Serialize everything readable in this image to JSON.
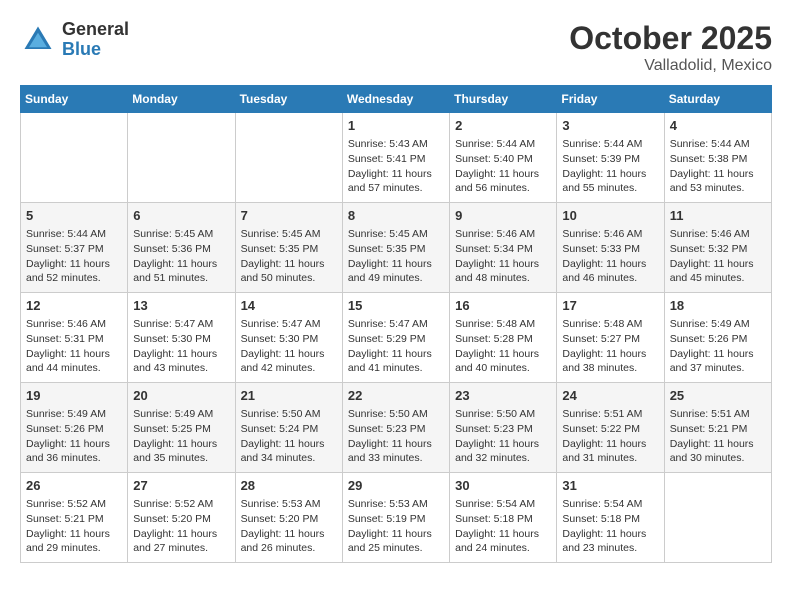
{
  "header": {
    "logo": {
      "general": "General",
      "blue": "Blue"
    },
    "month": "October 2025",
    "location": "Valladolid, Mexico"
  },
  "days_of_week": [
    "Sunday",
    "Monday",
    "Tuesday",
    "Wednesday",
    "Thursday",
    "Friday",
    "Saturday"
  ],
  "weeks": [
    [
      {
        "day": "",
        "sunrise": "",
        "sunset": "",
        "daylight": ""
      },
      {
        "day": "",
        "sunrise": "",
        "sunset": "",
        "daylight": ""
      },
      {
        "day": "",
        "sunrise": "",
        "sunset": "",
        "daylight": ""
      },
      {
        "day": "1",
        "sunrise": "Sunrise: 5:43 AM",
        "sunset": "Sunset: 5:41 PM",
        "daylight": "Daylight: 11 hours and 57 minutes."
      },
      {
        "day": "2",
        "sunrise": "Sunrise: 5:44 AM",
        "sunset": "Sunset: 5:40 PM",
        "daylight": "Daylight: 11 hours and 56 minutes."
      },
      {
        "day": "3",
        "sunrise": "Sunrise: 5:44 AM",
        "sunset": "Sunset: 5:39 PM",
        "daylight": "Daylight: 11 hours and 55 minutes."
      },
      {
        "day": "4",
        "sunrise": "Sunrise: 5:44 AM",
        "sunset": "Sunset: 5:38 PM",
        "daylight": "Daylight: 11 hours and 53 minutes."
      }
    ],
    [
      {
        "day": "5",
        "sunrise": "Sunrise: 5:44 AM",
        "sunset": "Sunset: 5:37 PM",
        "daylight": "Daylight: 11 hours and 52 minutes."
      },
      {
        "day": "6",
        "sunrise": "Sunrise: 5:45 AM",
        "sunset": "Sunset: 5:36 PM",
        "daylight": "Daylight: 11 hours and 51 minutes."
      },
      {
        "day": "7",
        "sunrise": "Sunrise: 5:45 AM",
        "sunset": "Sunset: 5:35 PM",
        "daylight": "Daylight: 11 hours and 50 minutes."
      },
      {
        "day": "8",
        "sunrise": "Sunrise: 5:45 AM",
        "sunset": "Sunset: 5:35 PM",
        "daylight": "Daylight: 11 hours and 49 minutes."
      },
      {
        "day": "9",
        "sunrise": "Sunrise: 5:46 AM",
        "sunset": "Sunset: 5:34 PM",
        "daylight": "Daylight: 11 hours and 48 minutes."
      },
      {
        "day": "10",
        "sunrise": "Sunrise: 5:46 AM",
        "sunset": "Sunset: 5:33 PM",
        "daylight": "Daylight: 11 hours and 46 minutes."
      },
      {
        "day": "11",
        "sunrise": "Sunrise: 5:46 AM",
        "sunset": "Sunset: 5:32 PM",
        "daylight": "Daylight: 11 hours and 45 minutes."
      }
    ],
    [
      {
        "day": "12",
        "sunrise": "Sunrise: 5:46 AM",
        "sunset": "Sunset: 5:31 PM",
        "daylight": "Daylight: 11 hours and 44 minutes."
      },
      {
        "day": "13",
        "sunrise": "Sunrise: 5:47 AM",
        "sunset": "Sunset: 5:30 PM",
        "daylight": "Daylight: 11 hours and 43 minutes."
      },
      {
        "day": "14",
        "sunrise": "Sunrise: 5:47 AM",
        "sunset": "Sunset: 5:30 PM",
        "daylight": "Daylight: 11 hours and 42 minutes."
      },
      {
        "day": "15",
        "sunrise": "Sunrise: 5:47 AM",
        "sunset": "Sunset: 5:29 PM",
        "daylight": "Daylight: 11 hours and 41 minutes."
      },
      {
        "day": "16",
        "sunrise": "Sunrise: 5:48 AM",
        "sunset": "Sunset: 5:28 PM",
        "daylight": "Daylight: 11 hours and 40 minutes."
      },
      {
        "day": "17",
        "sunrise": "Sunrise: 5:48 AM",
        "sunset": "Sunset: 5:27 PM",
        "daylight": "Daylight: 11 hours and 38 minutes."
      },
      {
        "day": "18",
        "sunrise": "Sunrise: 5:49 AM",
        "sunset": "Sunset: 5:26 PM",
        "daylight": "Daylight: 11 hours and 37 minutes."
      }
    ],
    [
      {
        "day": "19",
        "sunrise": "Sunrise: 5:49 AM",
        "sunset": "Sunset: 5:26 PM",
        "daylight": "Daylight: 11 hours and 36 minutes."
      },
      {
        "day": "20",
        "sunrise": "Sunrise: 5:49 AM",
        "sunset": "Sunset: 5:25 PM",
        "daylight": "Daylight: 11 hours and 35 minutes."
      },
      {
        "day": "21",
        "sunrise": "Sunrise: 5:50 AM",
        "sunset": "Sunset: 5:24 PM",
        "daylight": "Daylight: 11 hours and 34 minutes."
      },
      {
        "day": "22",
        "sunrise": "Sunrise: 5:50 AM",
        "sunset": "Sunset: 5:23 PM",
        "daylight": "Daylight: 11 hours and 33 minutes."
      },
      {
        "day": "23",
        "sunrise": "Sunrise: 5:50 AM",
        "sunset": "Sunset: 5:23 PM",
        "daylight": "Daylight: 11 hours and 32 minutes."
      },
      {
        "day": "24",
        "sunrise": "Sunrise: 5:51 AM",
        "sunset": "Sunset: 5:22 PM",
        "daylight": "Daylight: 11 hours and 31 minutes."
      },
      {
        "day": "25",
        "sunrise": "Sunrise: 5:51 AM",
        "sunset": "Sunset: 5:21 PM",
        "daylight": "Daylight: 11 hours and 30 minutes."
      }
    ],
    [
      {
        "day": "26",
        "sunrise": "Sunrise: 5:52 AM",
        "sunset": "Sunset: 5:21 PM",
        "daylight": "Daylight: 11 hours and 29 minutes."
      },
      {
        "day": "27",
        "sunrise": "Sunrise: 5:52 AM",
        "sunset": "Sunset: 5:20 PM",
        "daylight": "Daylight: 11 hours and 27 minutes."
      },
      {
        "day": "28",
        "sunrise": "Sunrise: 5:53 AM",
        "sunset": "Sunset: 5:20 PM",
        "daylight": "Daylight: 11 hours and 26 minutes."
      },
      {
        "day": "29",
        "sunrise": "Sunrise: 5:53 AM",
        "sunset": "Sunset: 5:19 PM",
        "daylight": "Daylight: 11 hours and 25 minutes."
      },
      {
        "day": "30",
        "sunrise": "Sunrise: 5:54 AM",
        "sunset": "Sunset: 5:18 PM",
        "daylight": "Daylight: 11 hours and 24 minutes."
      },
      {
        "day": "31",
        "sunrise": "Sunrise: 5:54 AM",
        "sunset": "Sunset: 5:18 PM",
        "daylight": "Daylight: 11 hours and 23 minutes."
      },
      {
        "day": "",
        "sunrise": "",
        "sunset": "",
        "daylight": ""
      }
    ]
  ]
}
